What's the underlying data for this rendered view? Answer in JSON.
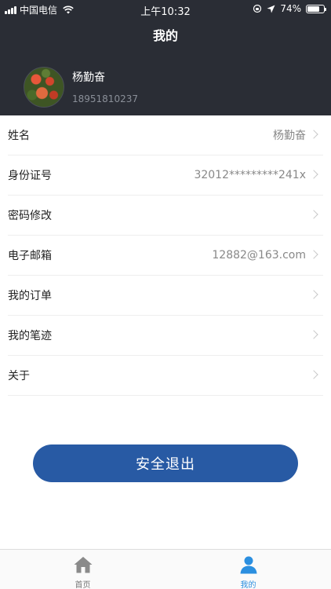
{
  "status_bar": {
    "carrier": "中国电信",
    "time": "上午10:32",
    "battery": "74%",
    "battery_level": 0.74
  },
  "header": {
    "title": "我的",
    "user_name": "杨勤奋",
    "user_phone": "18951810237"
  },
  "menu": {
    "items": [
      {
        "label": "姓名",
        "value": "杨勤奋"
      },
      {
        "label": "身份证号",
        "value": "32012*********241x"
      },
      {
        "label": "密码修改",
        "value": ""
      },
      {
        "label": "电子邮箱",
        "value": "12882@163.com"
      },
      {
        "label": "我的订单",
        "value": ""
      },
      {
        "label": "我的笔迹",
        "value": ""
      },
      {
        "label": "关于",
        "value": ""
      }
    ]
  },
  "logout_label": "安全退出",
  "tabbar": {
    "home_label": "首页",
    "mine_label": "我的",
    "active_color": "#2b8fe0",
    "inactive_color": "#888888"
  },
  "colors": {
    "header_bg": "#2a2d35",
    "button_bg": "#285aa4"
  }
}
